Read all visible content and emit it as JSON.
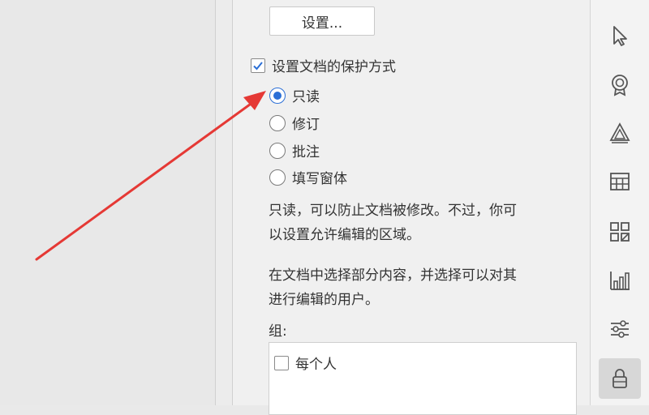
{
  "panel": {
    "settings_button": "设置...",
    "protect_checkbox_label": "设置文档的保护方式",
    "radio_options": [
      "只读",
      "修订",
      "批注",
      "填写窗体"
    ],
    "readonly_desc_line1": "只读，可以防止文档被修改。不过，你可",
    "readonly_desc_line2": "以设置允许编辑的区域。",
    "select_desc_line1": "在文档中选择部分内容，并选择可以对其",
    "select_desc_line2": "进行编辑的用户。",
    "group_label": "组:",
    "everyone_label": "每个人"
  },
  "toolbar": {
    "icons": [
      "cursor-icon",
      "badge-icon",
      "shapes-icon",
      "table-icon",
      "grid-apps-icon",
      "chart-icon",
      "sliders-icon",
      "lock-icon"
    ]
  },
  "colors": {
    "accent": "#2b6fd6",
    "arrow": "#e53935"
  }
}
